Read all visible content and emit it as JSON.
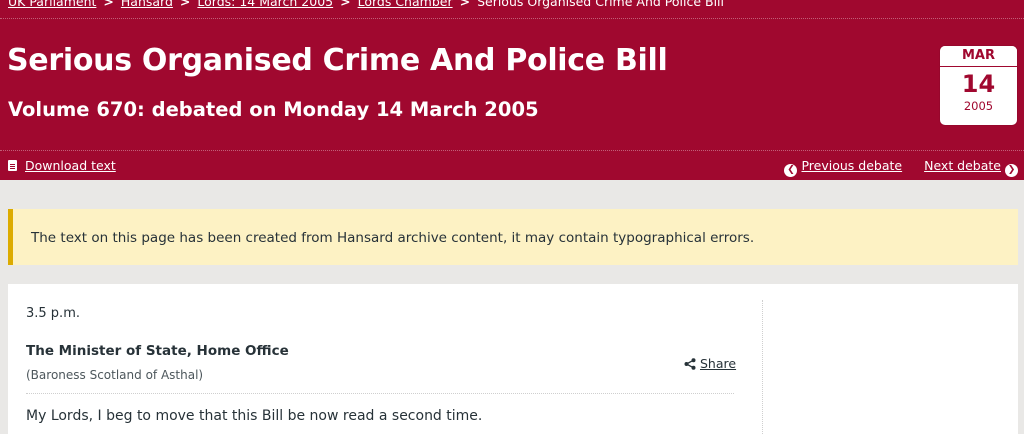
{
  "breadcrumb": {
    "items": [
      "UK Parliament",
      "Hansard",
      "Lords: 14 March 2005",
      "Lords Chamber"
    ],
    "current": "Serious Organised Crime And Police Bill"
  },
  "debate": {
    "title": "Serious Organised Crime And Police Bill",
    "subtitle": "Volume 670: debated on Monday 14 March 2005"
  },
  "date": {
    "month": "MAR",
    "day": "14",
    "year": "2005"
  },
  "nav": {
    "download": "Download text",
    "previous": "Previous debate",
    "next": "Next debate"
  },
  "notice": "The text on this page has been created from Hansard archive content, it may contain typographical errors.",
  "content": {
    "time": "3.5 p.m.",
    "speaker": "The Minister of State, Home Office",
    "speaker_detail": "(Baroness Scotland of Asthal)",
    "share": "Share",
    "speech": "My Lords, I beg to move that this Bill be now read a second time."
  },
  "colors": {
    "header": "#a0082f",
    "notice_bg": "#fdf2c4",
    "notice_border": "#dcab00"
  },
  "icons": [
    "document-icon",
    "chevron-left-icon",
    "chevron-right-icon",
    "share-icon"
  ]
}
